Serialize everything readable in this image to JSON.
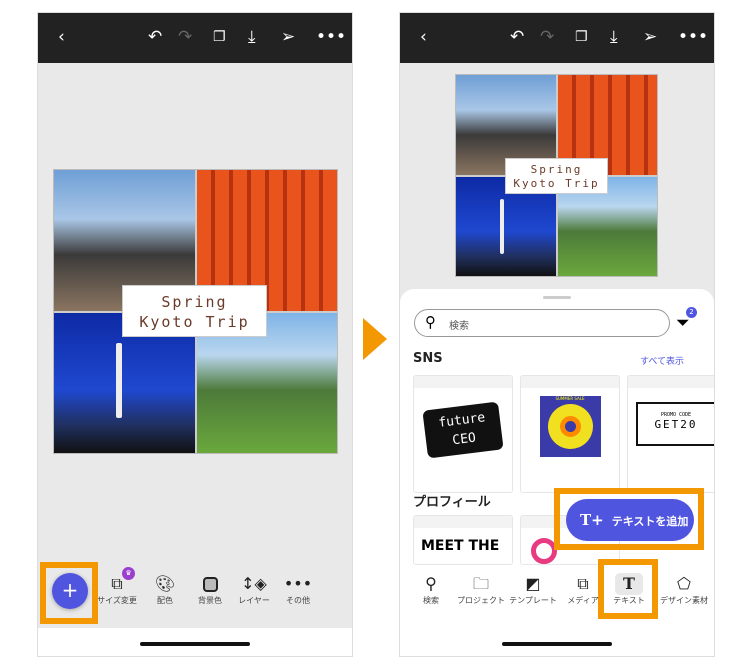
{
  "left_phone": {
    "collage_text": {
      "line1": "Spring",
      "line2": "Kyoto Trip"
    },
    "add_button": "+",
    "tools": [
      {
        "label": "サイズ変更",
        "icon": "resize-icon"
      },
      {
        "label": "配色",
        "icon": "palette-icon"
      },
      {
        "label": "背景色",
        "icon": "background-color-icon"
      },
      {
        "label": "レイヤー",
        "icon": "layers-icon"
      },
      {
        "label": "その他",
        "icon": "more-icon"
      }
    ]
  },
  "right_phone": {
    "collage_text": {
      "line1": "Spring",
      "line2": "Kyoto Trip"
    },
    "search_placeholder": "検索",
    "filter_badge": "2",
    "sns_title": "SNS",
    "show_all": "すべて表示",
    "cards": {
      "future": "future",
      "ceo": "CEO",
      "summer": "SUMMER SALE",
      "promo": "PROMO CODE",
      "code": "GET20"
    },
    "profile_title": "プロフィール",
    "profile_card": "MEET THE",
    "add_text_button": "テキストを追加",
    "nav": [
      {
        "label": "検索",
        "icon": "search-icon"
      },
      {
        "label": "プロジェクト",
        "icon": "folder-icon"
      },
      {
        "label": "テンプレート",
        "icon": "template-icon"
      },
      {
        "label": "メディア",
        "icon": "media-icon"
      },
      {
        "label": "テキスト",
        "icon": "text-icon"
      },
      {
        "label": "デザイン素材",
        "icon": "design-assets-icon"
      }
    ]
  },
  "colors": {
    "accent": "#5055e0",
    "highlight": "#f39800",
    "topbar": "#222222"
  }
}
